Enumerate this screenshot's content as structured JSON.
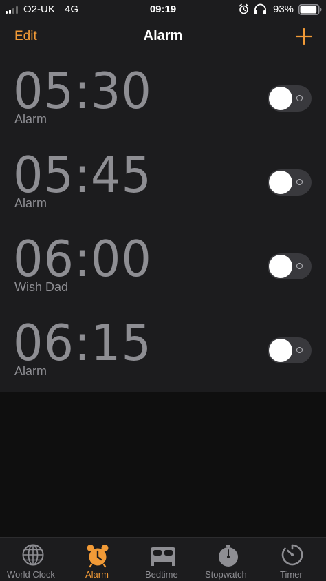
{
  "status_bar": {
    "carrier": "O2-UK",
    "network": "4G",
    "time": "09:19",
    "battery_percent": "93%",
    "signal_bars_filled": 2,
    "signal_bars_total": 4,
    "battery_level": 0.93
  },
  "nav": {
    "edit_label": "Edit",
    "title": "Alarm",
    "add_icon": "plus-icon"
  },
  "alarms": [
    {
      "time": "05:30",
      "label": "Alarm",
      "enabled": false
    },
    {
      "time": "05:45",
      "label": "Alarm",
      "enabled": false
    },
    {
      "time": "06:00",
      "label": "Wish Dad",
      "enabled": false
    },
    {
      "time": "06:15",
      "label": "Alarm",
      "enabled": false
    }
  ],
  "tabs": [
    {
      "label": "World Clock",
      "icon": "globe-icon",
      "active": false
    },
    {
      "label": "Alarm",
      "icon": "alarm-clock-icon",
      "active": true
    },
    {
      "label": "Bedtime",
      "icon": "bed-icon",
      "active": false
    },
    {
      "label": "Stopwatch",
      "icon": "stopwatch-icon",
      "active": false
    },
    {
      "label": "Timer",
      "icon": "timer-icon",
      "active": false
    }
  ],
  "colors": {
    "accent": "#f19a37",
    "inactive": "#8e8e93",
    "background": "#1c1c1e",
    "toggle_off": "#39393d"
  }
}
